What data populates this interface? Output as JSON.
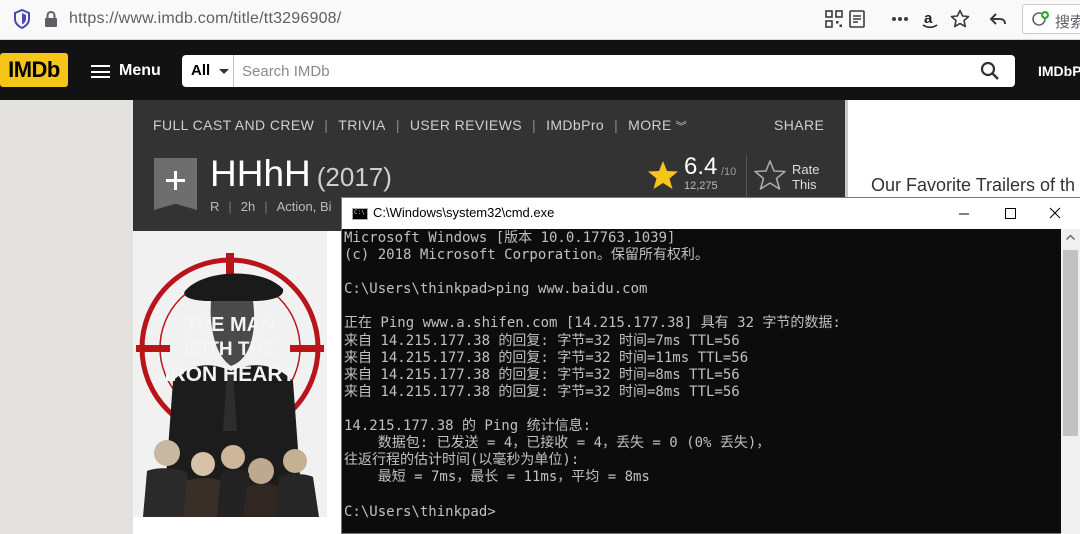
{
  "browser": {
    "url_host": "https://www.imdb.com",
    "url_path": "/title/tt3296908/",
    "search_label": "搜索"
  },
  "imdb": {
    "logo": "IMDb",
    "menu_label": "Menu",
    "search_category": "All",
    "search_placeholder": "Search IMDb",
    "pro_link": "IMDbPro"
  },
  "subnav": {
    "items": [
      "FULL CAST AND CREW",
      "TRIVIA",
      "USER REVIEWS",
      "IMDbPro",
      "MORE"
    ],
    "share": "SHARE"
  },
  "movie": {
    "title": "HHhH",
    "year": "(2017)",
    "rating_cert": "R",
    "runtime": "2h",
    "genres": "Action, Bi",
    "rating": "6.4",
    "rating_max": "/10",
    "votes": "12,275",
    "rate_label_1": "Rate",
    "rate_label_2": "This"
  },
  "poster": {
    "line1": "THE MAN",
    "line2": "WITH THE",
    "line3": "IRON HEART"
  },
  "right_panel": {
    "title": "Our Favorite Trailers of th"
  },
  "cmd": {
    "title": "C:\\Windows\\system32\\cmd.exe",
    "lines": [
      "Microsoft Windows [版本 10.0.17763.1039]",
      "(c) 2018 Microsoft Corporation。保留所有权利。",
      "",
      "C:\\Users\\thinkpad>ping www.baidu.com",
      "",
      "正在 Ping www.a.shifen.com [14.215.177.38] 具有 32 字节的数据:",
      "来自 14.215.177.38 的回复: 字节=32 时间=7ms TTL=56",
      "来自 14.215.177.38 的回复: 字节=32 时间=11ms TTL=56",
      "来自 14.215.177.38 的回复: 字节=32 时间=8ms TTL=56",
      "来自 14.215.177.38 的回复: 字节=32 时间=8ms TTL=56",
      "",
      "14.215.177.38 的 Ping 统计信息:",
      "    数据包: 已发送 = 4，已接收 = 4，丢失 = 0 (0% 丢失)，",
      "往返行程的估计时间(以毫秒为单位):",
      "    最短 = 7ms，最长 = 11ms，平均 = 8ms",
      "",
      "C:\\Users\\thinkpad>"
    ]
  },
  "colors": {
    "imdb_yellow": "#f5c518",
    "panel_dark": "#333333",
    "cmd_text": "#c0c0c0"
  }
}
